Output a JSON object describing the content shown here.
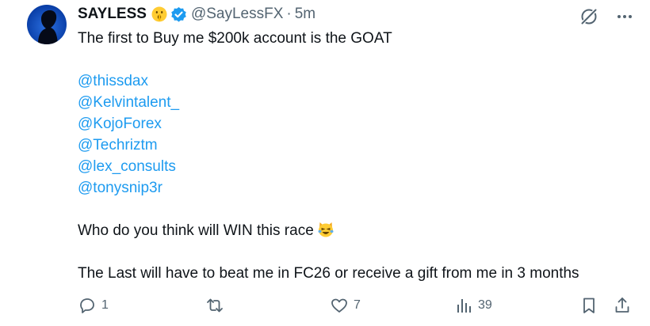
{
  "tweet": {
    "display_name": "SAYLESS",
    "name_emoji": "shushing-face-emoji",
    "verified_badge": "verified-badge-icon",
    "handle": "@SayLessFX",
    "separator": "·",
    "time": "5m",
    "lines": {
      "line1": "The first to Buy me $200k account is the GOAT",
      "mention1": "@thissdax",
      "mention2": "@Kelvintalent_",
      "mention3": "@KojoForex",
      "mention4": "@Techriztm",
      "mention5": "@lex_consults",
      "mention6": "@tonysnip3r",
      "question": "Who do you think will WIN this race",
      "question_emoji": "laughing-crying-cat-emoji",
      "closing": "The Last will have to beat me in FC26 or receive a gift from me in 3 months"
    }
  },
  "actions": {
    "reply_count": "1",
    "retweet_count": "",
    "like_count": "7",
    "views_count": "39"
  },
  "colors": {
    "text": "#0f1419",
    "muted": "#536471",
    "link": "#1d9bf0",
    "verified": "#1d9bf0"
  }
}
